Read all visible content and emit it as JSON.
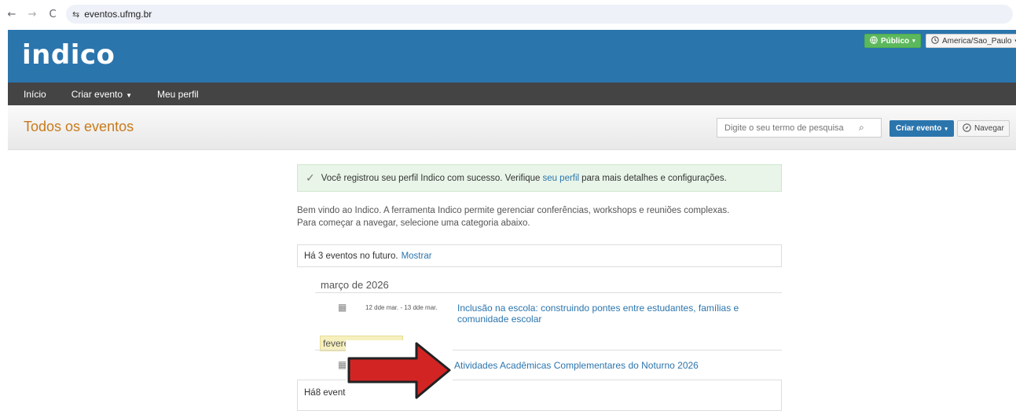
{
  "browser": {
    "back": "←",
    "forward": "→",
    "reload": "C",
    "site_info": "⇆",
    "url": "eventos.ufmg.br"
  },
  "header": {
    "logo": "indico",
    "public_label": "Público",
    "timezone_label": "America/Sao_Paulo"
  },
  "menu": {
    "items": [
      {
        "label": "Início"
      },
      {
        "label": "Criar evento"
      },
      {
        "label": "Meu perfil"
      }
    ]
  },
  "titlebar": {
    "title": "Todos os eventos",
    "search_placeholder": "Digite o seu termo de pesquisa",
    "create_label": "Criar evento",
    "navigate_label": "Navegar"
  },
  "alert": {
    "text_before": "Você registrou seu perfil Indico com sucesso. Verifique",
    "link": "seu perfil",
    "text_after": "para mais detalhes e configurações."
  },
  "welcome": {
    "line1": "Bem vindo ao Indico. A ferramenta Indico permite gerenciar conferências, workshops e reuniões complexas.",
    "line2": "Para começar a navegar, selecione uma categoria abaixo."
  },
  "future": {
    "text": "Há 3 eventos no futuro.",
    "link": "Mostrar"
  },
  "months": [
    {
      "label": "março de 2026",
      "events": [
        {
          "date": "12 dde mar. - 13 dde mar.",
          "title": "Inclusão na escola: construindo pontes entre estudantes, famílias e comunidade escolar"
        }
      ]
    },
    {
      "label": "fevere",
      "events": [
        {
          "date": "",
          "title": "Atividades Acadêmicas Complementares do Noturno 2026"
        }
      ]
    }
  ],
  "past": {
    "text": "Há8 evento"
  },
  "colors": {
    "header_blue": "#2b75ad",
    "menu_dark": "#444444",
    "title_orange": "#c87a1a",
    "arrow_red": "#d32424"
  }
}
